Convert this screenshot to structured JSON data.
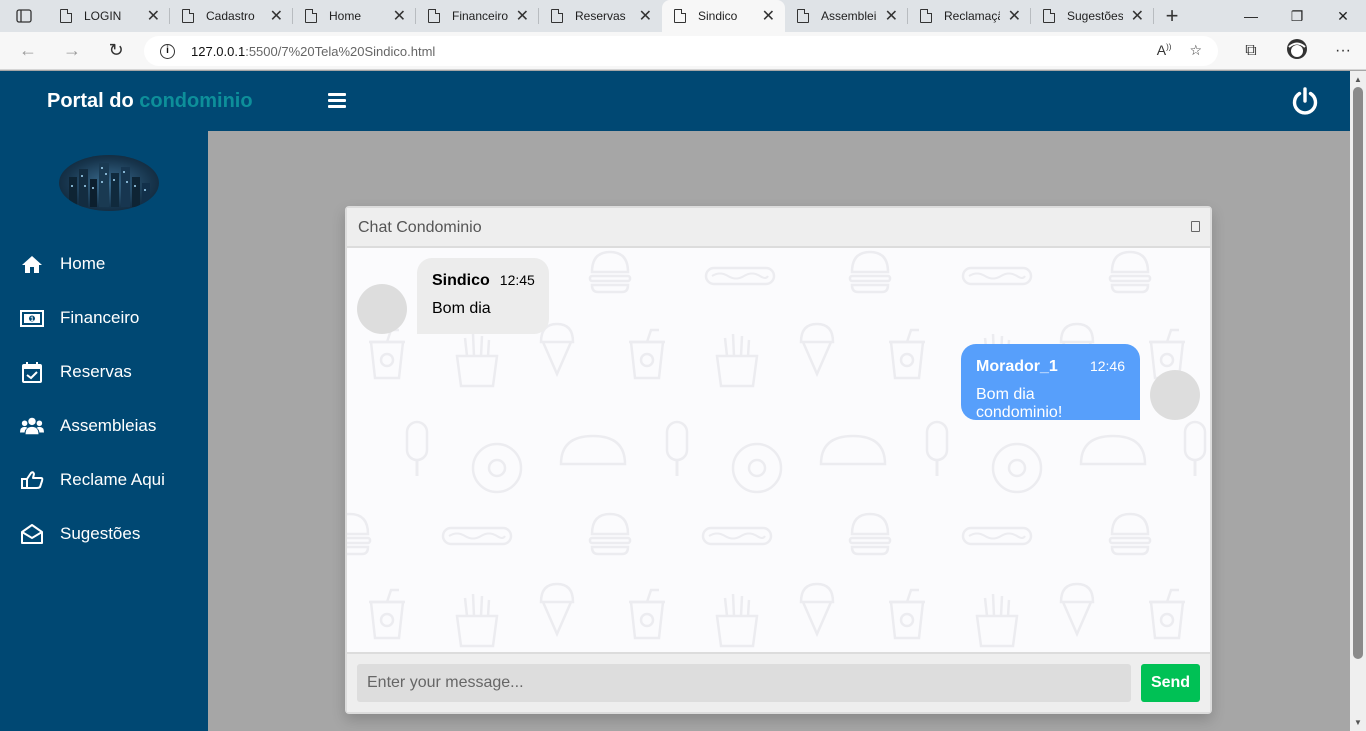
{
  "browser": {
    "tabs": [
      {
        "title": "LOGIN",
        "active": false
      },
      {
        "title": "Cadastro",
        "active": false
      },
      {
        "title": "Home",
        "active": false
      },
      {
        "title": "Financeiro",
        "active": false
      },
      {
        "title": "Reservas",
        "active": false
      },
      {
        "title": "Sindico",
        "active": true
      },
      {
        "title": "Assemblei",
        "active": false
      },
      {
        "title": "Reclamaçã",
        "active": false
      },
      {
        "title": "Sugestões",
        "active": false
      }
    ],
    "url_host": "127.0.0.1",
    "url_path": ":5500/7%20Tela%20Sindico.html"
  },
  "header": {
    "brand_main": "Portal do",
    "brand_accent": "condominio",
    "colors": {
      "bar": "#004873",
      "accent": "#0d8f9a"
    }
  },
  "sidebar": {
    "items": [
      {
        "label": "Home",
        "icon": "home-icon"
      },
      {
        "label": "Financeiro",
        "icon": "money-icon"
      },
      {
        "label": "Reservas",
        "icon": "calendar-check-icon"
      },
      {
        "label": "Assembleias",
        "icon": "users-icon"
      },
      {
        "label": "Reclame Aqui",
        "icon": "thumbs-hand-icon"
      },
      {
        "label": "Sugestões",
        "icon": "envelope-open-icon"
      }
    ]
  },
  "chat": {
    "title": "Chat Condominio",
    "messages": [
      {
        "side": "left",
        "name": "Sindico",
        "time": "12:45",
        "text": "Bom dia"
      },
      {
        "side": "right",
        "name": "Morador_1",
        "time": "12:46",
        "text": "Bom dia condominio!"
      }
    ],
    "input_placeholder": "Enter your message...",
    "send_label": "Send",
    "colors": {
      "send": "#00c155",
      "own_bubble": "#579ffb",
      "other_bubble": "#ececec"
    }
  }
}
